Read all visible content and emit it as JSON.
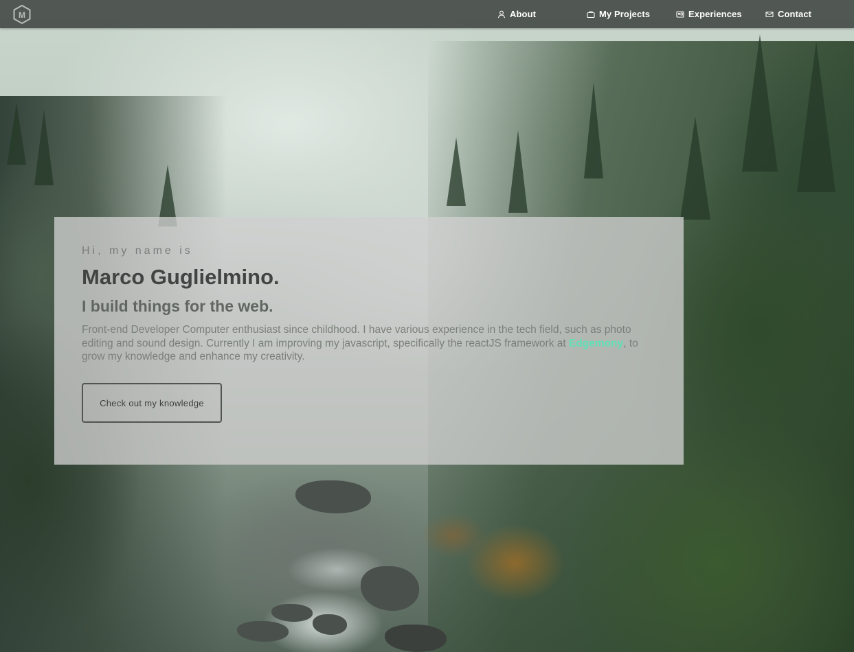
{
  "brand": {
    "logo_letter": "M"
  },
  "nav": {
    "items": [
      {
        "label": "About",
        "icon": "user-icon"
      },
      {
        "label": "My Projects",
        "icon": "briefcase-icon"
      },
      {
        "label": "Experiences",
        "icon": "id-card-icon"
      },
      {
        "label": "Contact",
        "icon": "mail-icon"
      }
    ]
  },
  "hero": {
    "greeting": "Hi, my name is",
    "name": "Marco Guglielmino.",
    "tagline": "I build things for the web.",
    "description_before": "Front-end Developer Computer enthusiast since childhood. I have various experience in the tech field, such as photo editing and sound design. Currently I am improving my javascript, specifically the reactJS framework at ",
    "company_link": "Edgemony",
    "description_after": ", to grow my knowledge and enhance my creativity.",
    "cta_label": "Check out my knowledge"
  },
  "colors": {
    "navbar": "#404642",
    "link_accent": "#5fe0b6",
    "card": "#d0d0d0",
    "heading": "#404442"
  }
}
